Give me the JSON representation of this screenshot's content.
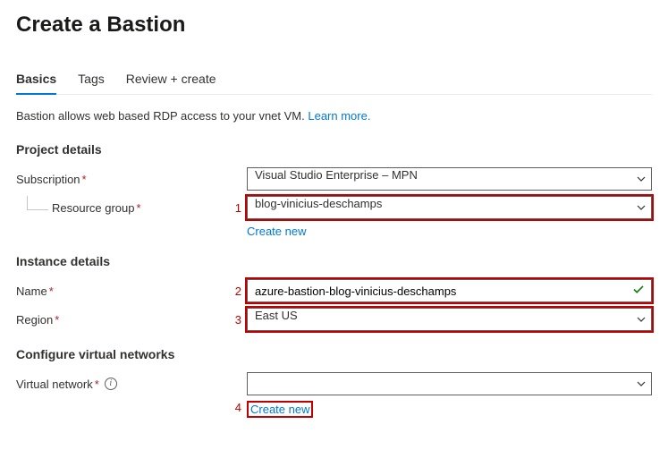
{
  "page_title": "Create a Bastion",
  "tabs": {
    "basics": "Basics",
    "tags": "Tags",
    "review": "Review + create"
  },
  "description": {
    "text": "Bastion allows web based RDP access to your vnet VM.  ",
    "learn_more": "Learn more."
  },
  "sections": {
    "project": "Project details",
    "instance": "Instance details",
    "network": "Configure virtual networks"
  },
  "labels": {
    "subscription": "Subscription",
    "resource_group": "Resource group",
    "name": "Name",
    "region": "Region",
    "virtual_network": "Virtual network"
  },
  "values": {
    "subscription": "Visual Studio Enterprise – MPN",
    "resource_group": "blog-vinicius-deschamps",
    "name": "azure-bastion-blog-vinicius-deschamps",
    "region": "East US",
    "virtual_network": ""
  },
  "aux": {
    "create_new": "Create new"
  },
  "markers": {
    "m1": "1",
    "m2": "2",
    "m3": "3",
    "m4": "4"
  },
  "required_mark": "*",
  "info_glyph": "i"
}
